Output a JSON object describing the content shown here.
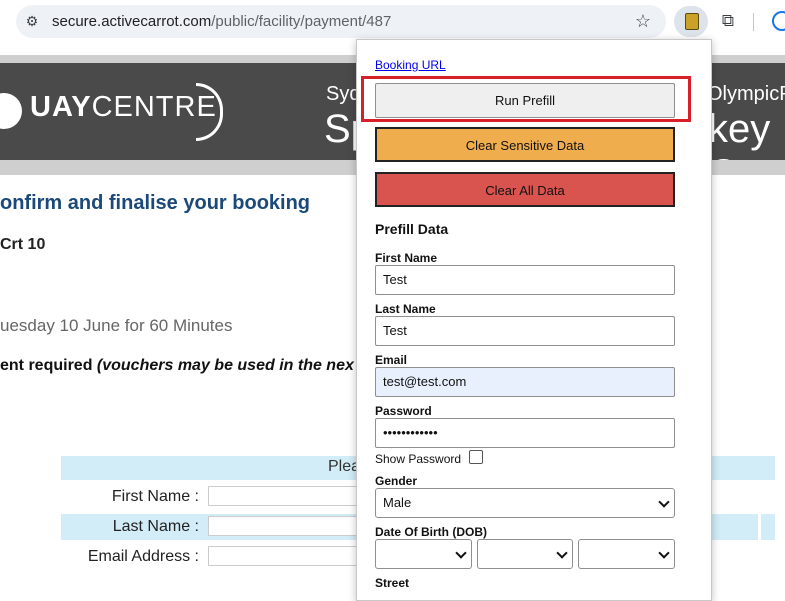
{
  "browser": {
    "url_host": "secure.activecarrot.com",
    "url_path": "/public/facility/payment/487"
  },
  "page": {
    "hero": {
      "logo_prefix": "UAY",
      "logo_suffix": "CENTRE",
      "right_small": "Syd",
      "right_large": "Sp",
      "right_small_2": "OlympicP",
      "right_large_2": "key Ce"
    },
    "heading": "onfirm and finalise your booking",
    "court": "Crt 10",
    "date_text": "uesday 10 June for 60 Minutes",
    "payment_text": "ent required ",
    "payment_italic": "(vouchers may be used in the nex",
    "form_header": "Plea",
    "labels": {
      "first_name": "First Name :",
      "last_name": "Last Name :",
      "email": "Email Address :"
    }
  },
  "popup": {
    "booking_link": "Booking URL",
    "run_prefill": "Run Prefill",
    "clear_sensitive": "Clear Sensitive Data",
    "clear_all": "Clear All Data",
    "section_title": "Prefill Data",
    "fields": {
      "first_name_label": "First Name",
      "first_name_value": "Test",
      "last_name_label": "Last Name",
      "last_name_value": "Test",
      "email_label": "Email",
      "email_value": "test@test.com",
      "password_label": "Password",
      "password_value": "••••••••••••",
      "show_password_label": "Show Password",
      "show_password_checked": false,
      "gender_label": "Gender",
      "gender_value": "Male",
      "dob_label": "Date Of Birth (DOB)",
      "dob_day": "",
      "dob_month": "",
      "dob_year": "",
      "street_label": "Street"
    }
  }
}
